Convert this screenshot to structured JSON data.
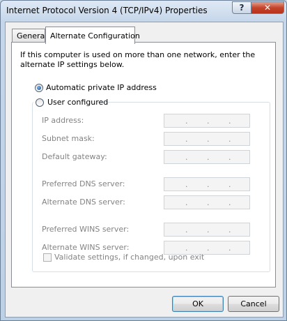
{
  "window": {
    "title": "Internet Protocol Version 4 (TCP/IPv4) Properties",
    "help_glyph": "?",
    "close_glyph": "✕"
  },
  "tabs": [
    {
      "label": "General",
      "selected": false
    },
    {
      "label": "Alternate Configuration",
      "selected": true
    }
  ],
  "description": "If this computer is used on more than one network, enter the alternate IP settings below.",
  "options": {
    "automatic": {
      "label": "Automatic private IP address",
      "checked": true
    },
    "user": {
      "label": "User configured",
      "checked": false
    }
  },
  "fields": {
    "ip_address": {
      "label": "IP address:",
      "value": "",
      "dots": [
        ".",
        ".",
        "."
      ]
    },
    "subnet_mask": {
      "label": "Subnet mask:",
      "value": "",
      "dots": [
        ".",
        ".",
        "."
      ]
    },
    "default_gateway": {
      "label": "Default gateway:",
      "value": "",
      "dots": [
        ".",
        ".",
        "."
      ]
    },
    "preferred_dns": {
      "label": "Preferred DNS server:",
      "value": "",
      "dots": [
        ".",
        ".",
        "."
      ]
    },
    "alternate_dns": {
      "label": "Alternate DNS server:",
      "value": "",
      "dots": [
        ".",
        ".",
        "."
      ]
    },
    "preferred_wins": {
      "label": "Preferred WINS server:",
      "value": "",
      "dots": [
        ".",
        ".",
        "."
      ]
    },
    "alternate_wins": {
      "label": "Alternate WINS server:",
      "value": "",
      "dots": [
        ".",
        ".",
        "."
      ]
    }
  },
  "validate": {
    "label": "Validate settings, if changed, upon exit",
    "checked": false,
    "enabled": false
  },
  "buttons": {
    "ok": "OK",
    "cancel": "Cancel"
  },
  "colors": {
    "close_button": "#c4452c",
    "disabled_text": "#838383",
    "focus_border": "#3c7fb1"
  }
}
